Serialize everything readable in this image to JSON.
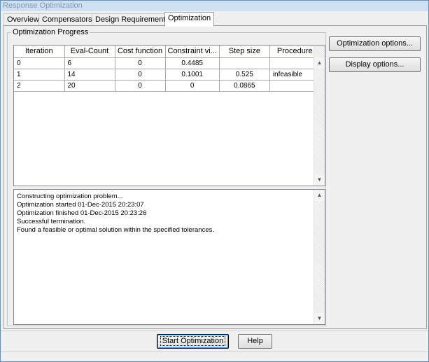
{
  "window": {
    "title": "Response Optimization"
  },
  "tabs": [
    {
      "label": "Overview"
    },
    {
      "label": "Compensators"
    },
    {
      "label": "Design Requirements"
    },
    {
      "label": "Optimization"
    }
  ],
  "progress": {
    "group_label": "Optimization Progress",
    "columns": [
      "Iteration",
      "Eval-Count",
      "Cost function",
      "Constraint vi...",
      "Step size",
      "Procedure"
    ],
    "rows": [
      [
        "0",
        "6",
        "0",
        "0.4485",
        "",
        ""
      ],
      [
        "1",
        "14",
        "0",
        "0.1001",
        "0.525",
        "infeasible"
      ],
      [
        "2",
        "20",
        "0",
        "0",
        "0.0865",
        ""
      ]
    ]
  },
  "log": {
    "lines": [
      "Constructing optimization problem...",
      "Optimization started 01-Dec-2015 20:23:07",
      "Optimization finished 01-Dec-2015 20:23:26",
      "Successful termination.",
      "Found a feasible or optimal solution within the specified tolerances."
    ]
  },
  "side_buttons": {
    "optimization_options": "Optimization options...",
    "display_options": "Display options..."
  },
  "bottom_buttons": {
    "start": "Start Optimization",
    "help": "Help"
  },
  "icons": {
    "scroll_up": "arrow-up-icon",
    "scroll_down": "arrow-down-icon"
  }
}
